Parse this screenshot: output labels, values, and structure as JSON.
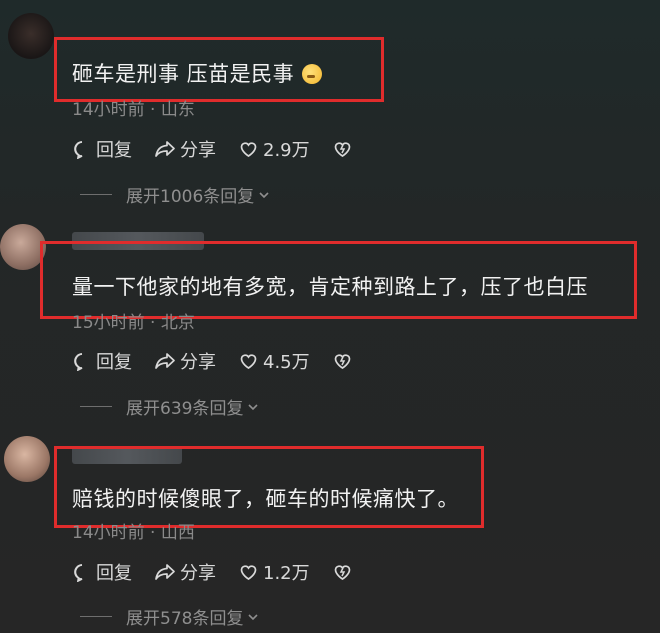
{
  "comments": [
    {
      "text": "砸车是刑事 压苗是民事",
      "meta": "14小时前 · 山东",
      "reply_label": "回复",
      "share_label": "分享",
      "like_count": "2.9万",
      "expand_label": "展开1006条回复"
    },
    {
      "text": "量一下他家的地有多宽，肯定种到路上了，压了也白压",
      "meta": "15小时前 · 北京",
      "reply_label": "回复",
      "share_label": "分享",
      "like_count": "4.5万",
      "expand_label": "展开639条回复"
    },
    {
      "text": "赔钱的时候傻眼了，砸车的时候痛快了。",
      "meta": "14小时前 · 山西",
      "reply_label": "回复",
      "share_label": "分享",
      "like_count": "1.2万",
      "expand_label": "展开578条回复"
    }
  ],
  "colors": {
    "highlight_box": "#e02c2c",
    "background": "#232727",
    "meta_text": "#8a8a8a"
  },
  "icons": [
    "reply-icon",
    "share-icon",
    "like-icon",
    "dislike-icon",
    "chevron-down-icon",
    "emoji-icon"
  ]
}
